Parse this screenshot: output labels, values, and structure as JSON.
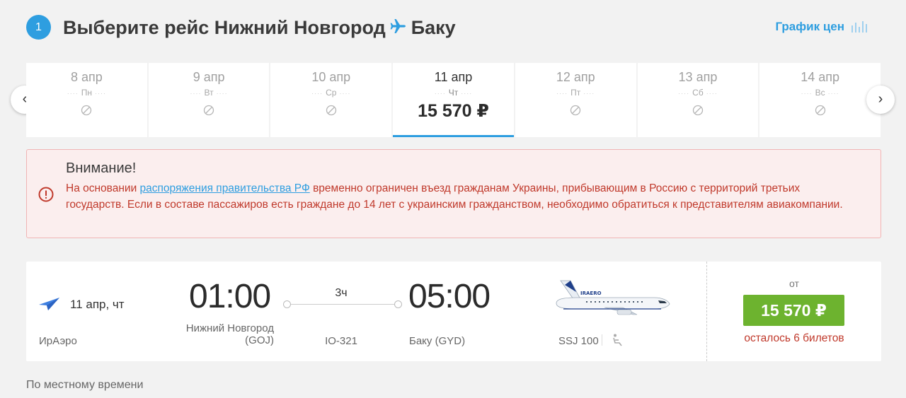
{
  "header": {
    "step": "1",
    "title_prefix": "Выберите рейс",
    "from_city": "Нижний Новгород",
    "to_city": "Баку",
    "price_chart_label": "График цен"
  },
  "dates": [
    {
      "date": "8 апр",
      "weekday": "Пн",
      "price": null,
      "active": false
    },
    {
      "date": "9 апр",
      "weekday": "Вт",
      "price": null,
      "active": false
    },
    {
      "date": "10 апр",
      "weekday": "Ср",
      "price": null,
      "active": false
    },
    {
      "date": "11 апр",
      "weekday": "Чт",
      "price": "15 570 ₽",
      "active": true
    },
    {
      "date": "12 апр",
      "weekday": "Пт",
      "price": null,
      "active": false
    },
    {
      "date": "13 апр",
      "weekday": "Сб",
      "price": null,
      "active": false
    },
    {
      "date": "14 апр",
      "weekday": "Вс",
      "price": null,
      "active": false
    }
  ],
  "alert": {
    "title": "Внимание!",
    "text_before_link": "На основании ",
    "link_text": "распоряжения правительства РФ",
    "text_after_link": " временно ограничен въезд гражданам Украины, прибывающим в Россию с территорий третьих государств. Если в составе пассажиров есть граждане до 14 лет с украинским гражданством, необходимо обратиться к представителям авиакомпании."
  },
  "flight": {
    "date": "11 апр, чт",
    "airline": "ИрАэро",
    "departure_time": "01:00",
    "departure_city_line1": "Нижний Новгород",
    "departure_city_line2": "(GOJ)",
    "duration": "3ч",
    "flight_number": "IO-321",
    "arrival_time": "05:00",
    "arrival_city": "Баку (GYD)",
    "aircraft": "SSJ 100",
    "price_from_label": "от",
    "price": "15 570 ₽",
    "tickets_left": "осталось 6 билетов"
  },
  "footer_note": "По местному времени",
  "colors": {
    "accent": "#2e9ee0",
    "buy_button": "#6db32f",
    "alert_text": "#c0392b",
    "alert_bg": "#fbeeee",
    "alert_border": "#f0b5b5"
  },
  "icons": {
    "plane": "plane-icon",
    "bars": "bar-chart-icon",
    "unavailable": "no-flights-icon",
    "alert": "exclamation-icon",
    "seat": "seat-icon"
  }
}
